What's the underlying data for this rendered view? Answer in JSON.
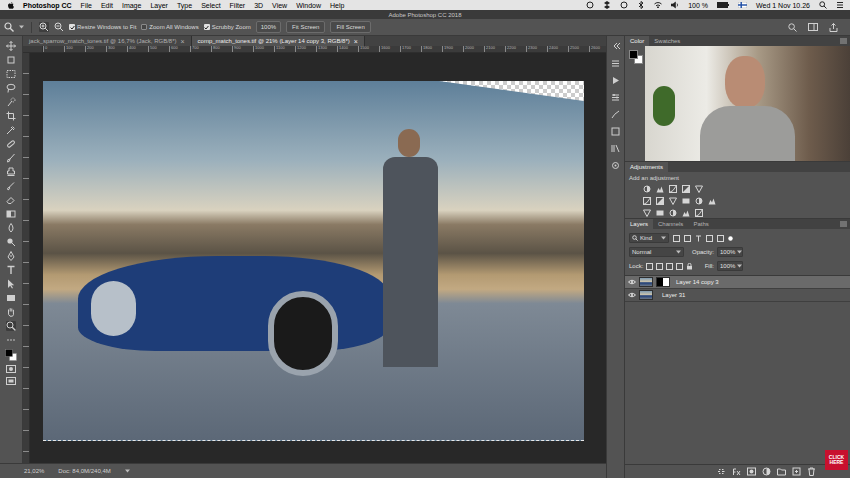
{
  "menubar": {
    "app": "Photoshop CC",
    "items": [
      "File",
      "Edit",
      "Image",
      "Layer",
      "Type",
      "Select",
      "Filter",
      "3D",
      "View",
      "Window",
      "Help"
    ],
    "battery": "100 %",
    "clock": "Wed 1 Nov 10.26"
  },
  "window": {
    "title": "Adobe Photoshop CC 2018"
  },
  "options_bar": {
    "checkboxes": [
      {
        "label": "Resize Windows to Fit",
        "checked": true
      },
      {
        "label": "Zoom All Windows",
        "checked": false
      },
      {
        "label": "Scrubby Zoom",
        "checked": true
      }
    ],
    "zoom_value": "100%",
    "buttons": [
      "Fit Screen",
      "Fill Screen"
    ]
  },
  "document_tabs": [
    {
      "label": "jack_sparrow_match_tones.tif @ 16,7% (Jack, RGB/8*)",
      "close": "×",
      "selected": false
    },
    {
      "label": "comp_match_tones.tif @ 21% (Layer 14 copy 3, RGB/8*)",
      "close": "×",
      "selected": true
    }
  ],
  "ruler": {
    "ticks": [
      "0",
      "100",
      "200",
      "300",
      "400",
      "500",
      "600",
      "700",
      "800",
      "900",
      "1000",
      "1100",
      "1200",
      "1300",
      "1400",
      "1500",
      "1600",
      "1700",
      "1800",
      "1900",
      "2000",
      "2100",
      "2200",
      "2300",
      "2400",
      "2500",
      "2600"
    ]
  },
  "status_bar": {
    "zoom": "21,02%",
    "doc": "Doc: 84,0M/240,4M"
  },
  "color_panel": {
    "tabs": [
      {
        "label": "Color",
        "selected": true
      },
      {
        "label": "Swatches",
        "selected": false
      }
    ]
  },
  "adjustments": {
    "title": "Adjustments",
    "hint": "Add an adjustment"
  },
  "layers_panel": {
    "tabs": [
      {
        "label": "Layers",
        "selected": true
      },
      {
        "label": "Channels",
        "selected": false
      },
      {
        "label": "Paths",
        "selected": false
      }
    ],
    "filter": "Kind",
    "blend_mode": "Normal",
    "opacity_label": "Opacity:",
    "opacity": "100%",
    "lock_label": "Lock:",
    "fill_label": "Fill:",
    "fill": "100%",
    "layers": [
      {
        "name": "Layer 14 copy 3",
        "selected": true,
        "visible": true,
        "has_mask": true
      },
      {
        "name": "Layer 31",
        "selected": false,
        "visible": true,
        "has_mask": false
      }
    ]
  },
  "badge": {
    "text": "CLICK HERE"
  }
}
